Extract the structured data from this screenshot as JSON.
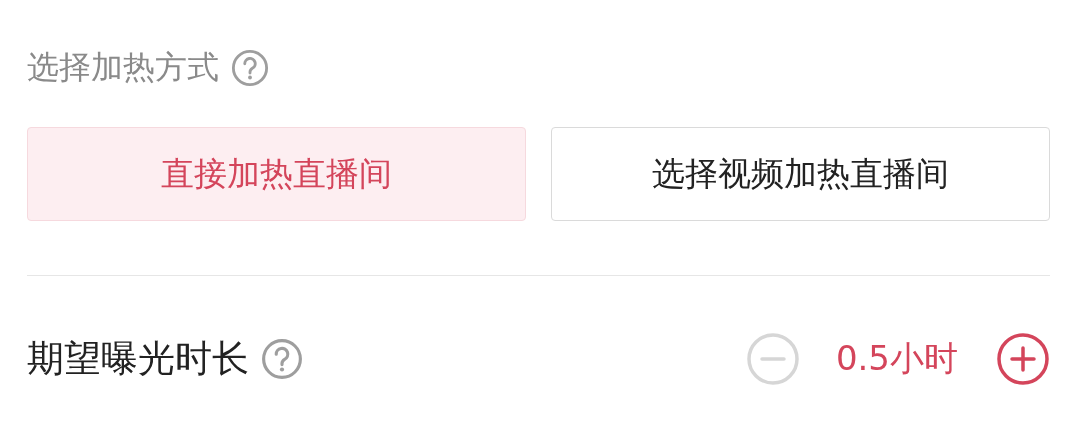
{
  "heat_method": {
    "label": "选择加热方式",
    "options": [
      {
        "label": "直接加热直播间",
        "selected": true
      },
      {
        "label": "选择视频加热直播间",
        "selected": false
      }
    ]
  },
  "duration": {
    "label": "期望曝光时长",
    "value": "0.5小时",
    "decrease_disabled": true,
    "increase_disabled": false
  }
}
